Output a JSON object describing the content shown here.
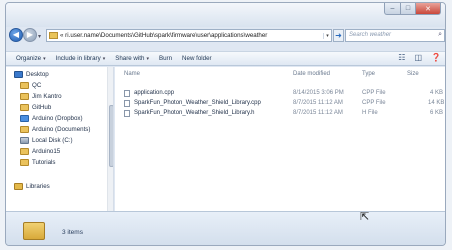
{
  "window": {
    "controls": {
      "minimize": "–",
      "maximize": "□",
      "close": "✕"
    }
  },
  "nav": {
    "back_glyph": "◀",
    "forward_glyph": "▶",
    "recent_glyph": "▾"
  },
  "address": {
    "path": "« ri.user.name\\Documents\\GitHub\\spark\\firmware\\user\\applications\\weather",
    "dropdown_glyph": "▾",
    "refresh_glyph": "➜"
  },
  "search": {
    "placeholder": "Search weather",
    "icon": "search-icon"
  },
  "toolbar": {
    "organize": "Organize",
    "include_in_library": "Include in library",
    "share_with": "Share with",
    "burn": "Burn",
    "new_folder": "New folder",
    "caret": "▾",
    "views_glyph": "☷",
    "preview_glyph": "◫",
    "help_glyph": "❓"
  },
  "sidebar": {
    "items": [
      {
        "label": "Desktop",
        "icon": "desktop-icon"
      },
      {
        "label": "QC",
        "icon": "folder-icon"
      },
      {
        "label": "Jim Kantro",
        "icon": "folder-icon"
      },
      {
        "label": "GitHub",
        "icon": "folder-icon"
      },
      {
        "label": "Arduino (Dropbox)",
        "icon": "folder-icon"
      },
      {
        "label": "Arduino (Documents)",
        "icon": "folder-icon"
      },
      {
        "label": "Local Disk (C:)",
        "icon": "disk-icon"
      },
      {
        "label": "Arduino15",
        "icon": "folder-icon"
      },
      {
        "label": "Tutorials",
        "icon": "folder-icon"
      },
      {
        "label": "Libraries",
        "icon": "library-icon"
      }
    ]
  },
  "columns": {
    "name": "Name",
    "date_modified": "Date modified",
    "type": "Type",
    "size": "Size"
  },
  "files": [
    {
      "name": "application.cpp",
      "date": "8/14/2015 3:06 PM",
      "type": "CPP File",
      "size": "4 KB"
    },
    {
      "name": "SparkFun_Photon_Weather_Shield_Library.cpp",
      "date": "8/7/2015 11:12 AM",
      "type": "CPP File",
      "size": "14 KB"
    },
    {
      "name": "SparkFun_Photon_Weather_Shield_Library.h",
      "date": "8/7/2015 11:12 AM",
      "type": "H File",
      "size": "6 KB"
    }
  ],
  "status": {
    "item_count": "3 items"
  },
  "cursor_glyph": "⇱"
}
